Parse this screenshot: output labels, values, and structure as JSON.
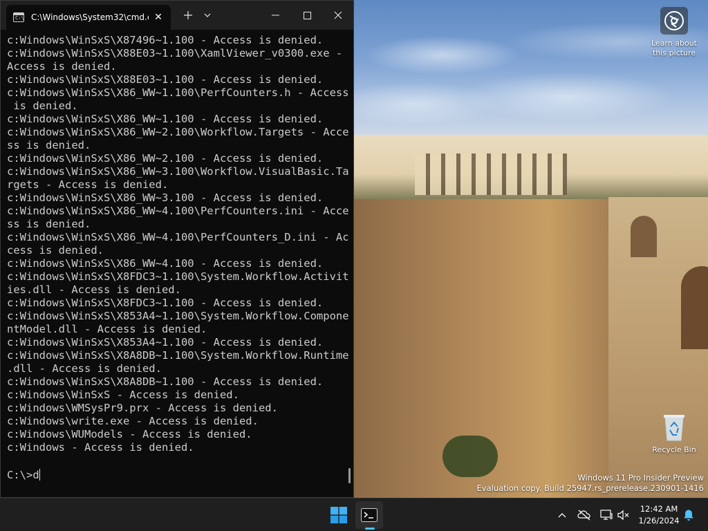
{
  "terminal": {
    "tab_title": "C:\\Windows\\System32\\cmd.e",
    "lines": [
      "c:Windows\\WinSxS\\X87496~1.100 - Access is denied.",
      "c:Windows\\WinSxS\\X88E03~1.100\\XamlViewer_v0300.exe -",
      "Access is denied.",
      "c:Windows\\WinSxS\\X88E03~1.100 - Access is denied.",
      "c:Windows\\WinSxS\\X86_WW~1.100\\PerfCounters.h - Access",
      " is denied.",
      "c:Windows\\WinSxS\\X86_WW~1.100 - Access is denied.",
      "c:Windows\\WinSxS\\X86_WW~2.100\\Workflow.Targets - Acce",
      "ss is denied.",
      "c:Windows\\WinSxS\\X86_WW~2.100 - Access is denied.",
      "c:Windows\\WinSxS\\X86_WW~3.100\\Workflow.VisualBasic.Ta",
      "rgets - Access is denied.",
      "c:Windows\\WinSxS\\X86_WW~3.100 - Access is denied.",
      "c:Windows\\WinSxS\\X86_WW~4.100\\PerfCounters.ini - Acce",
      "ss is denied.",
      "c:Windows\\WinSxS\\X86_WW~4.100\\PerfCounters_D.ini - Ac",
      "cess is denied.",
      "c:Windows\\WinSxS\\X86_WW~4.100 - Access is denied.",
      "c:Windows\\WinSxS\\X8FDC3~1.100\\System.Workflow.Activit",
      "ies.dll - Access is denied.",
      "c:Windows\\WinSxS\\X8FDC3~1.100 - Access is denied.",
      "c:Windows\\WinSxS\\X853A4~1.100\\System.Workflow.Compone",
      "ntModel.dll - Access is denied.",
      "c:Windows\\WinSxS\\X853A4~1.100 - Access is denied.",
      "c:Windows\\WinSxS\\X8A8DB~1.100\\System.Workflow.Runtime",
      ".dll - Access is denied.",
      "c:Windows\\WinSxS\\X8A8DB~1.100 - Access is denied.",
      "c:Windows\\WinSxS - Access is denied.",
      "c:Windows\\WMSysPr9.prx - Access is denied.",
      "c:Windows\\write.exe - Access is denied.",
      "c:Windows\\WUModels - Access is denied.",
      "c:Windows - Access is denied."
    ],
    "prompt": "C:\\>d"
  },
  "desktop": {
    "learn_about_picture": "Learn about this picture",
    "recycle_bin": "Recycle Bin",
    "watermark_line1": "Windows 11 Pro Insider Preview",
    "watermark_line2": "Evaluation copy. Build 25947.rs_prerelease.230901-1416"
  },
  "taskbar": {
    "time": "12:42 AM",
    "date": "1/26/2024",
    "accent_color": "#4cc2ff"
  },
  "icons": {
    "tab": "cmd-icon",
    "start": "windows-logo-icon",
    "terminal": "terminal-icon",
    "tray": [
      "chevron-up-icon",
      "network-off-icon",
      "display-icon",
      "volume-muted-icon",
      "bell-icon"
    ]
  }
}
